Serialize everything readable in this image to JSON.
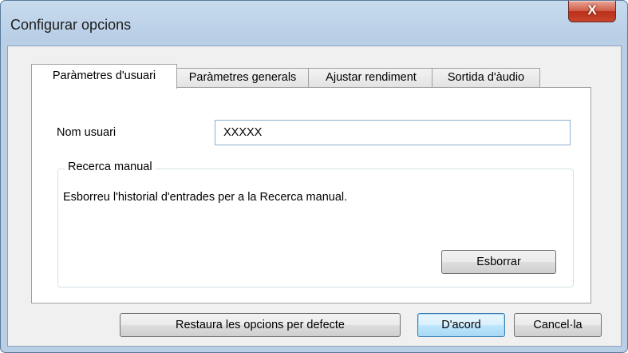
{
  "window": {
    "title": "Configurar opcions",
    "close_glyph": "X",
    "close_icon": "close-icon"
  },
  "tabs": [
    {
      "label": "Paràmetres d'usuari",
      "active": true
    },
    {
      "label": "Paràmetres generals",
      "active": false
    },
    {
      "label": "Ajustar rendiment",
      "active": false
    },
    {
      "label": "Sortida d'àudio",
      "active": false
    }
  ],
  "user_settings": {
    "username_label": "Nom usuari",
    "username_value": "XXXXX",
    "manual_search": {
      "group_title": "Recerca manual",
      "description": "Esborreu l'historial d'entrades per a la Recerca manual.",
      "clear_button": "Esborrar"
    }
  },
  "footer": {
    "restore_button": "Restaura les opcions per defecte",
    "ok_button": "D'acord",
    "cancel_button": "Cancel·la"
  },
  "colors": {
    "accent": "#3c7fb1",
    "close_button": "#c8452d"
  }
}
